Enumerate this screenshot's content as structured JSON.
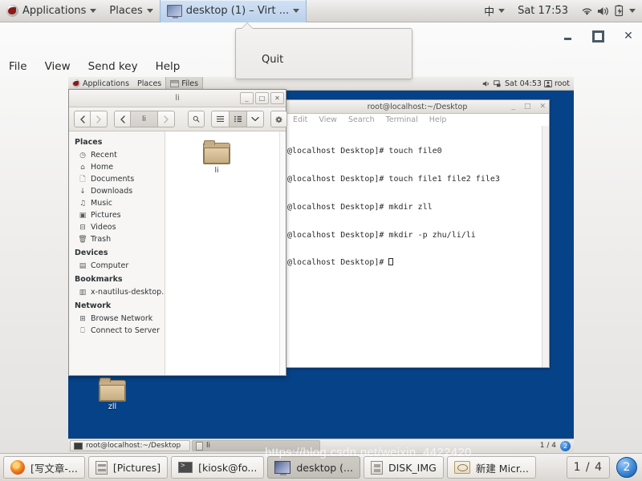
{
  "host_panel": {
    "applications_label": "Applications",
    "places_label": "Places",
    "active_window_label": "desktop (1) – Virt ...",
    "ime_label": "中",
    "clock": "Sat 17:53",
    "icons": [
      "wifi-icon",
      "volume-icon",
      "battery-icon"
    ]
  },
  "virt_manager": {
    "menu": [
      "File",
      "View",
      "Send key",
      "Help"
    ],
    "window_controls": [
      "minimize",
      "maximize",
      "close"
    ],
    "popup_menu": {
      "items": [
        "Quit"
      ]
    }
  },
  "guest": {
    "panel": {
      "applications_label": "Applications",
      "places_label": "Places",
      "window_label": "Files",
      "clock": "Sat 04:53",
      "user": "root"
    },
    "desktop_icons": [
      {
        "label": "zll",
        "type": "folder"
      }
    ],
    "terminal": {
      "title": "root@localhost:~/Desktop",
      "menu": [
        "Edit",
        "View",
        "Search",
        "Terminal",
        "Help"
      ],
      "lines": [
        "@localhost Desktop]# touch file0",
        "@localhost Desktop]# touch file1 file2 file3",
        "@localhost Desktop]# mkdir zll",
        "@localhost Desktop]# mkdir -p zhu/li/li"
      ],
      "prompt": "@localhost Desktop]# "
    },
    "files_window": {
      "title": "li",
      "breadcrumb": "li",
      "toolbar_icons": [
        "back-icon",
        "forward-icon",
        "search-icon",
        "list-view-icon",
        "grid-view-icon",
        "chevron-down-icon",
        "gear-icon"
      ],
      "sidebar": [
        {
          "header": "Places",
          "items": [
            {
              "label": "Recent",
              "icon": "clock-icon"
            },
            {
              "label": "Home",
              "icon": "home-icon"
            },
            {
              "label": "Documents",
              "icon": "document-icon"
            },
            {
              "label": "Downloads",
              "icon": "download-icon"
            },
            {
              "label": "Music",
              "icon": "music-icon"
            },
            {
              "label": "Pictures",
              "icon": "camera-icon"
            },
            {
              "label": "Videos",
              "icon": "video-icon"
            },
            {
              "label": "Trash",
              "icon": "trash-icon"
            }
          ]
        },
        {
          "header": "Devices",
          "items": [
            {
              "label": "Computer",
              "icon": "computer-icon"
            }
          ]
        },
        {
          "header": "Bookmarks",
          "items": [
            {
              "label": "x-nautilus-desktop...",
              "icon": "desktop-icon"
            }
          ]
        },
        {
          "header": "Network",
          "items": [
            {
              "label": "Browse Network",
              "icon": "network-icon"
            },
            {
              "label": "Connect to Server",
              "icon": "server-icon"
            }
          ]
        }
      ],
      "files": [
        {
          "label": "li",
          "type": "folder"
        }
      ]
    },
    "taskbar": {
      "tasks": [
        {
          "label": "root@localhost:~/Desktop",
          "icon": "terminal-icon",
          "pressed": false
        },
        {
          "label": "li",
          "icon": "files-icon",
          "pressed": true
        }
      ],
      "pager": "1 / 4",
      "badge": "2"
    }
  },
  "host_taskbar": {
    "tasks": [
      {
        "label": "[写文章-...",
        "icon": "firefox-icon",
        "pressed": false
      },
      {
        "label": "[Pictures]",
        "icon": "files-icon",
        "pressed": false
      },
      {
        "label": "[kiosk@fo...",
        "icon": "terminal-icon",
        "pressed": false
      },
      {
        "label": "desktop (...",
        "icon": "virt-viewer-icon",
        "pressed": true
      },
      {
        "label": "DISK_IMG",
        "icon": "disk-icon",
        "pressed": false
      },
      {
        "label": "新建 Micr...",
        "icon": "word-icon",
        "pressed": false
      }
    ],
    "pager": "1 / 4",
    "badge": "2"
  },
  "watermark": "https://blog.csdn.net/weixin_4422420",
  "colors": {
    "desktop_blue": "#064288",
    "panel_gray": "#e3e1de",
    "accent_blue": "#b9d0ea",
    "folder_tan": "#c7ad81"
  }
}
